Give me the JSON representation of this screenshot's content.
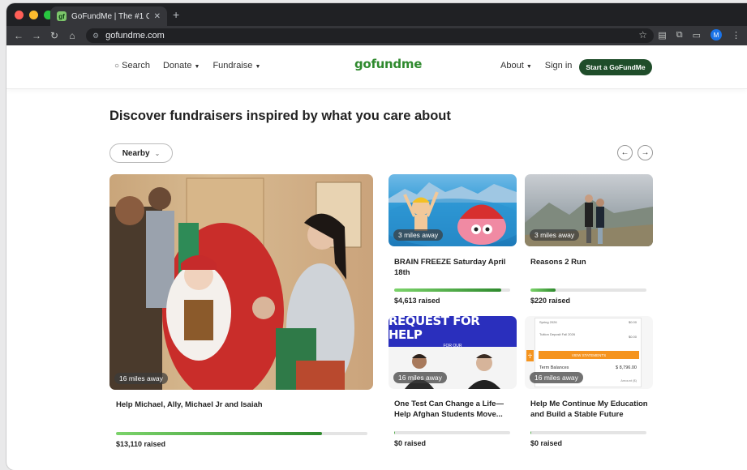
{
  "browser": {
    "tab_title": "GoFundMe | The #1 Crowdfun",
    "favicon": "gf",
    "url": "gofundme.com",
    "avatar_letter": "M"
  },
  "header": {
    "search": "Search",
    "donate": "Donate",
    "fundraise": "Fundraise",
    "logo": "gofundme",
    "about": "About",
    "signin": "Sign in",
    "cta": "Start a GoFundMe"
  },
  "main": {
    "heading": "Discover fundraisers inspired by what you care about",
    "filter": "Nearby"
  },
  "cards": [
    {
      "title": "Help Michael, Ally, Michael Jr and Isaiah",
      "distance": "16 miles away",
      "raised": "$13,110 raised",
      "progress": 0.82
    },
    {
      "title": "BRAIN FREEZE Saturday April 18th",
      "distance": "3 miles away",
      "raised": "$4,613 raised",
      "progress": 0.92
    },
    {
      "title": "Reasons 2 Run",
      "distance": "3 miles away",
      "raised": "$220 raised",
      "progress": 0.22
    },
    {
      "title": "One Test Can Change a Life—Help Afghan Students Move...",
      "distance": "16 miles away",
      "raised": "$0 raised",
      "progress": 0.01,
      "poster_text": "REQUEST FOR HELP",
      "poster_sub": "FOR OUR"
    },
    {
      "title": "Help Me Continue My Education and Build a Stable Future",
      "distance": "16 miles away",
      "raised": "$0 raised",
      "progress": 0.01,
      "statement": {
        "row1": "Spring 2026",
        "row1_val": "$0.00",
        "row2": "Tuition Deposit Fall 2026",
        "row2_val": "$0.00",
        "button": "VIEW STATEMENTS",
        "label": "Term Balances",
        "amount": "$ 8,796.00",
        "sub": "Amount ($)"
      }
    }
  ]
}
